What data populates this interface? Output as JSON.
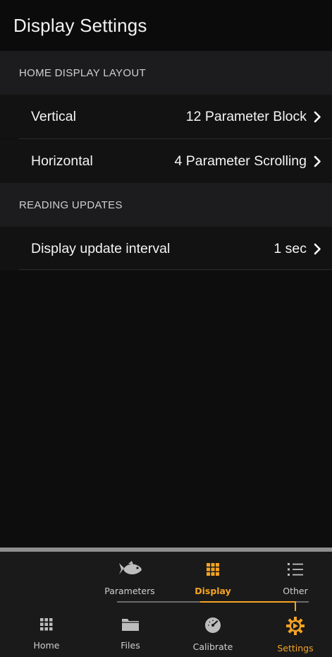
{
  "header": {
    "title": "Display Settings"
  },
  "sections": [
    {
      "title": "HOME DISPLAY LAYOUT",
      "rows": [
        {
          "label": "Vertical",
          "value": "12 Parameter Block"
        },
        {
          "label": "Horizontal",
          "value": "4 Parameter Scrolling"
        }
      ]
    },
    {
      "title": "READING UPDATES",
      "rows": [
        {
          "label": "Display update interval",
          "value": "1 sec"
        }
      ]
    }
  ],
  "subtabs": [
    {
      "label": "Parameters",
      "icon": "fish-icon",
      "active": false
    },
    {
      "label": "Display",
      "icon": "grid-icon",
      "active": true
    },
    {
      "label": "Other",
      "icon": "list-icon",
      "active": false
    }
  ],
  "tabs": [
    {
      "label": "Home",
      "icon": "grid-icon",
      "active": false
    },
    {
      "label": "Files",
      "icon": "folder-icon",
      "active": false
    },
    {
      "label": "Calibrate",
      "icon": "gauge-icon",
      "active": false
    },
    {
      "label": "Settings",
      "icon": "gear-icon",
      "active": true
    }
  ],
  "colors": {
    "accent": "#f5a322",
    "background": "#0d0d0d",
    "section": "#1c1c1e"
  }
}
